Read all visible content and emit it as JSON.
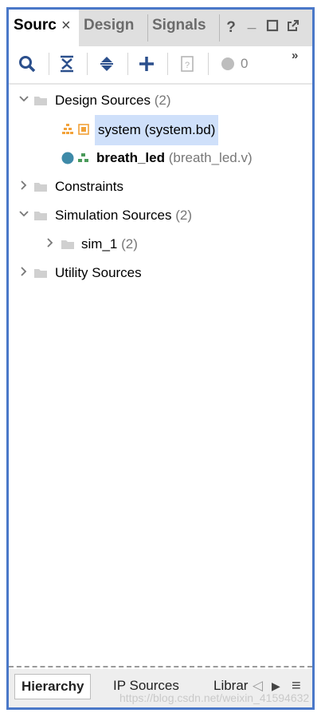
{
  "tabs": [
    {
      "label": "Sourc",
      "active": true,
      "close": "×"
    },
    {
      "label": "Design",
      "active": false
    },
    {
      "label": "Signals",
      "active": false
    }
  ],
  "window_buttons": {
    "help": "?",
    "minimize": "_",
    "maximize": "☐",
    "float": "⧉"
  },
  "toolbar": {
    "icons": [
      "search-icon",
      "collapse-all-icon",
      "expand-all-icon",
      "add-icon",
      "properties-icon",
      "status-dot-icon"
    ],
    "status_count": "0",
    "overflow": "»"
  },
  "tree": [
    {
      "label": "Design Sources",
      "count": "(2)",
      "expanded": true
    },
    {
      "label": "system (system.bd)",
      "selected": true
    },
    {
      "label": "breath_led",
      "file": "(breath_led.v)"
    },
    {
      "label": "Constraints",
      "expanded": false
    },
    {
      "label": "Simulation Sources",
      "count": "(2)",
      "expanded": true
    },
    {
      "label": "sim_1",
      "count": "(2)",
      "expanded": false
    },
    {
      "label": "Utility Sources",
      "expanded": false
    }
  ],
  "bottom_tabs": [
    {
      "label": "Hierarchy",
      "active": true
    },
    {
      "label": "IP Sources",
      "active": false
    },
    {
      "label": "Librar",
      "active": false
    }
  ],
  "bottom_controls": {
    "prev": "◁",
    "next": "▶",
    "menu": "≡"
  },
  "watermark": "https://blog.csdn.net/weixin_41594632",
  "colors": {
    "accent_border": "#4a78c8",
    "selection": "#cfe0fa",
    "toolbar_icon": "#2b4f8c",
    "status_dot": "#3e8aa8"
  }
}
